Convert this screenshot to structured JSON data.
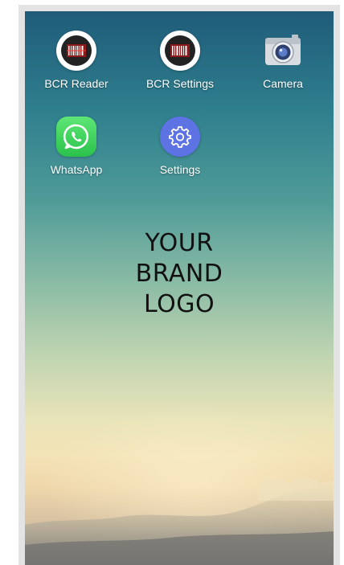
{
  "home_screen": {
    "apps": [
      {
        "label": "BCR Reader",
        "icon": "barcode-reader-icon"
      },
      {
        "label": "BCR Settings",
        "icon": "barcode-settings-icon"
      },
      {
        "label": "Camera",
        "icon": "camera-icon"
      },
      {
        "label": "WhatsApp",
        "icon": "whatsapp-icon"
      },
      {
        "label": "Settings",
        "icon": "gear-icon"
      }
    ],
    "brand_logo": {
      "line1": "YOUR",
      "line2": "BRAND",
      "line3": "LOGO"
    }
  },
  "colors": {
    "whatsapp_green": "#2ac24b",
    "settings_blue": "#5d73e3",
    "bcr_red": "#c0392b",
    "sky_top": "#1f5b79",
    "horizon": "#f3e3b6"
  }
}
